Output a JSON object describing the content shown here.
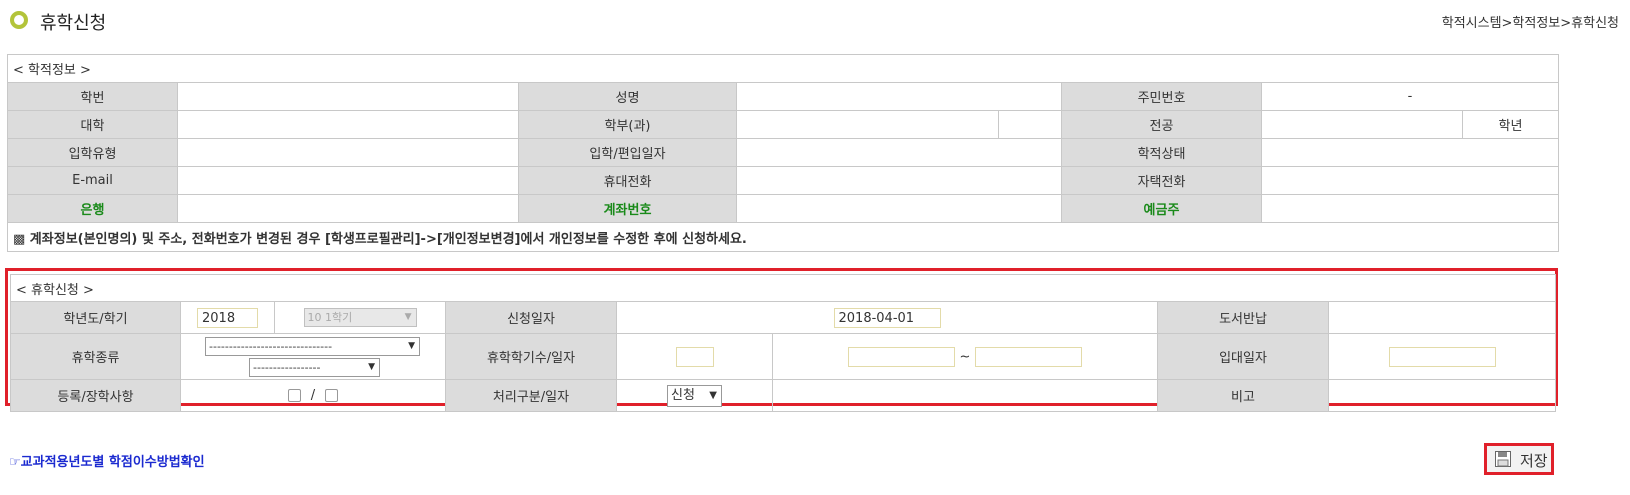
{
  "header": {
    "title": "휴학신청",
    "breadcrumb": "학적시스템>학적정보>휴학신청"
  },
  "info": {
    "caption": "< 학적정보 >",
    "rows": [
      [
        "학번",
        "",
        "성명",
        "",
        "주민번호",
        "-"
      ],
      [
        "대학",
        "",
        "학부(과)",
        "",
        "전공",
        "학년"
      ],
      [
        "입학유형",
        "",
        "입학/편입일자",
        "",
        "학적상태",
        ""
      ],
      [
        "E-mail",
        "",
        "휴대전화",
        "",
        "자택전화",
        ""
      ],
      [
        "은행",
        "",
        "계좌번호",
        "",
        "예금주",
        ""
      ]
    ],
    "notice": "▩ 계좌정보(본인명의) 및 주소, 전화번호가 변경된 경우 [학생프로필관리]->[개인정보변경]에서 개인정보를 수정한 후에 신청하세요."
  },
  "leave": {
    "caption": "< 휴학신청 >",
    "year_label": "학년도/학기",
    "year_value": "2018",
    "semester_value": "10 1학기",
    "apply_date_label": "신청일자",
    "apply_date_value": "2018-04-01",
    "library_label": "도서반납",
    "type_label": "휴학종류",
    "type_select1": "-------------------------------",
    "type_select2": "-----------------",
    "count_label": "휴학학기수/일자",
    "range_sep": "~",
    "enlist_label": "입대일자",
    "reg_label": "등록/장학사항",
    "reg_sep": "/",
    "process_label": "처리구분/일자",
    "process_value": "신청",
    "remark_label": "비고"
  },
  "footer": {
    "link": "☞교과적용년도별 학점이수방법확인",
    "save": "저장"
  },
  "colors": {
    "highlight_border": "#e0202a",
    "green_text": "#1a8a1a",
    "link_blue": "#1b2ad0",
    "header_cell": "#dcdcdc"
  }
}
